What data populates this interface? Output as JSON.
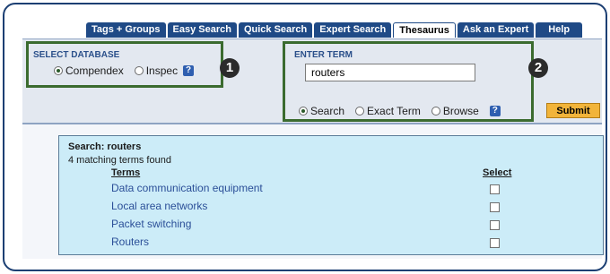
{
  "tabs": [
    {
      "label": "Tags + Groups",
      "active": false
    },
    {
      "label": "Easy Search",
      "active": false
    },
    {
      "label": "Quick Search",
      "active": false
    },
    {
      "label": "Expert Search",
      "active": false
    },
    {
      "label": "Thesaurus",
      "active": true
    },
    {
      "label": "Ask an Expert",
      "active": false
    },
    {
      "label": "Help",
      "active": false
    }
  ],
  "database": {
    "label": "SELECT DATABASE",
    "options": [
      {
        "label": "Compendex",
        "selected": true
      },
      {
        "label": "Inspec",
        "selected": false
      }
    ],
    "help": "?"
  },
  "term": {
    "label": "ENTER TERM",
    "value": "routers",
    "modes": [
      {
        "label": "Search",
        "selected": true
      },
      {
        "label": "Exact Term",
        "selected": false
      },
      {
        "label": "Browse",
        "selected": false
      }
    ],
    "help": "?"
  },
  "callouts": {
    "one": "1",
    "two": "2"
  },
  "submit_label": "Submit",
  "results": {
    "search_line": "Search: routers",
    "count_line": "4 matching terms found",
    "terms_header": "Terms",
    "select_header": "Select",
    "terms": [
      "Data communication equipment",
      "Local area networks",
      "Packet switching",
      "Routers"
    ]
  },
  "colors": {
    "tab_blue": "#1f4a86",
    "callout_green": "#3b6b2f",
    "results_bg": "#ccecf8",
    "submit_orange": "#f2b43a",
    "link_blue": "#2b4f98"
  }
}
